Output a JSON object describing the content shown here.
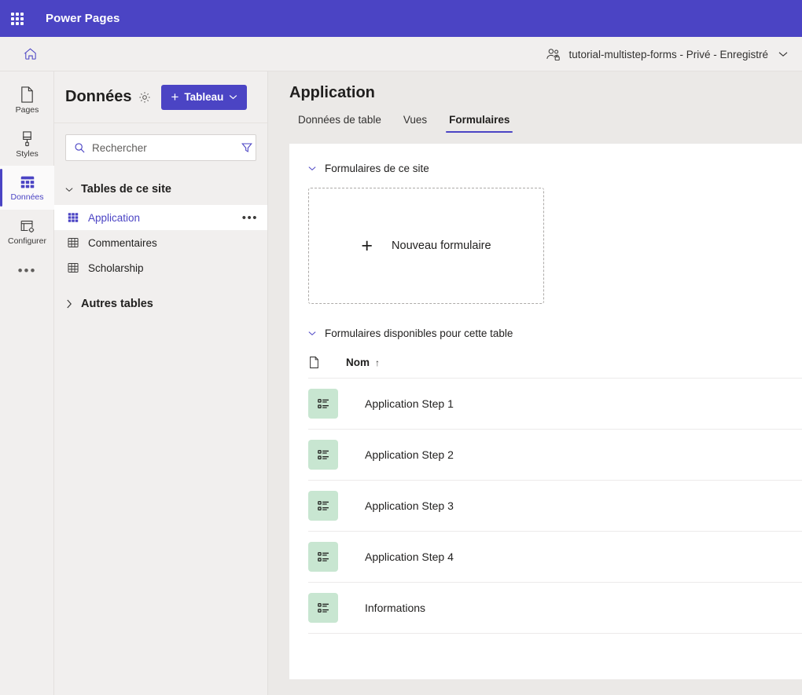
{
  "topbar": {
    "waffle_icon": "waffle-grid-icon",
    "app_title": "Power Pages"
  },
  "secondbar": {
    "home_icon": "home-icon",
    "site_icon": "people-lock-icon",
    "site_text": "tutorial-multistep-forms - Privé - Enregistré",
    "chevron_icon": "chevron-down-icon"
  },
  "rail": {
    "items": [
      {
        "label": "Pages",
        "icon": "page-icon",
        "selected": false
      },
      {
        "label": "Styles",
        "icon": "brush-icon",
        "selected": false
      },
      {
        "label": "Données",
        "icon": "data-grid-icon",
        "selected": true
      },
      {
        "label": "Configurer",
        "icon": "setup-window-icon",
        "selected": false
      }
    ],
    "more_label": "•••"
  },
  "panel": {
    "title": "Données",
    "gear_icon": "gear-icon",
    "new_table_label": "Tableau",
    "new_table_plus": "+",
    "new_table_chevron": "⌄",
    "search": {
      "placeholder": "Rechercher",
      "value": "",
      "search_icon": "search-icon",
      "filter_icon": "filter-funnel-icon"
    },
    "groups": [
      {
        "label": "Tables de ce site",
        "expanded": true,
        "chevron": "⌄",
        "items": [
          {
            "label": "Application",
            "icon": "table-filled-icon",
            "active": true,
            "overflow": "•••"
          },
          {
            "label": "Commentaires",
            "icon": "table-icon",
            "active": false
          },
          {
            "label": "Scholarship",
            "icon": "table-icon",
            "active": false
          }
        ]
      },
      {
        "label": "Autres tables",
        "expanded": false,
        "chevron": "›",
        "items": []
      }
    ]
  },
  "main": {
    "title": "Application",
    "tabs": [
      {
        "label": "Données de table",
        "active": false
      },
      {
        "label": "Vues",
        "active": false
      },
      {
        "label": "Formulaires",
        "active": true
      }
    ],
    "site_forms_section": {
      "title": "Formulaires de ce site",
      "chevron": "⌄",
      "new_form_plus": "+",
      "new_form_label": "Nouveau formulaire"
    },
    "available_forms_section": {
      "title": "Formulaires disponibles pour cette table",
      "chevron": "⌄",
      "columns": {
        "icon_header": "file-icon",
        "name_header": "Nom",
        "sort_indicator": "↑"
      },
      "rows": [
        {
          "name": "Application Step 1",
          "icon": "form-list-icon"
        },
        {
          "name": "Application Step 2",
          "icon": "form-list-icon"
        },
        {
          "name": "Application Step 3",
          "icon": "form-list-icon"
        },
        {
          "name": "Application Step 4",
          "icon": "form-list-icon"
        },
        {
          "name": "Informations",
          "icon": "form-list-icon"
        }
      ]
    }
  },
  "colors": {
    "brand_purple": "#4b44c4",
    "chrome_grey": "#f1efee",
    "page_grey": "#ebe9e7",
    "form_icon_green": "#c8e6d1"
  }
}
